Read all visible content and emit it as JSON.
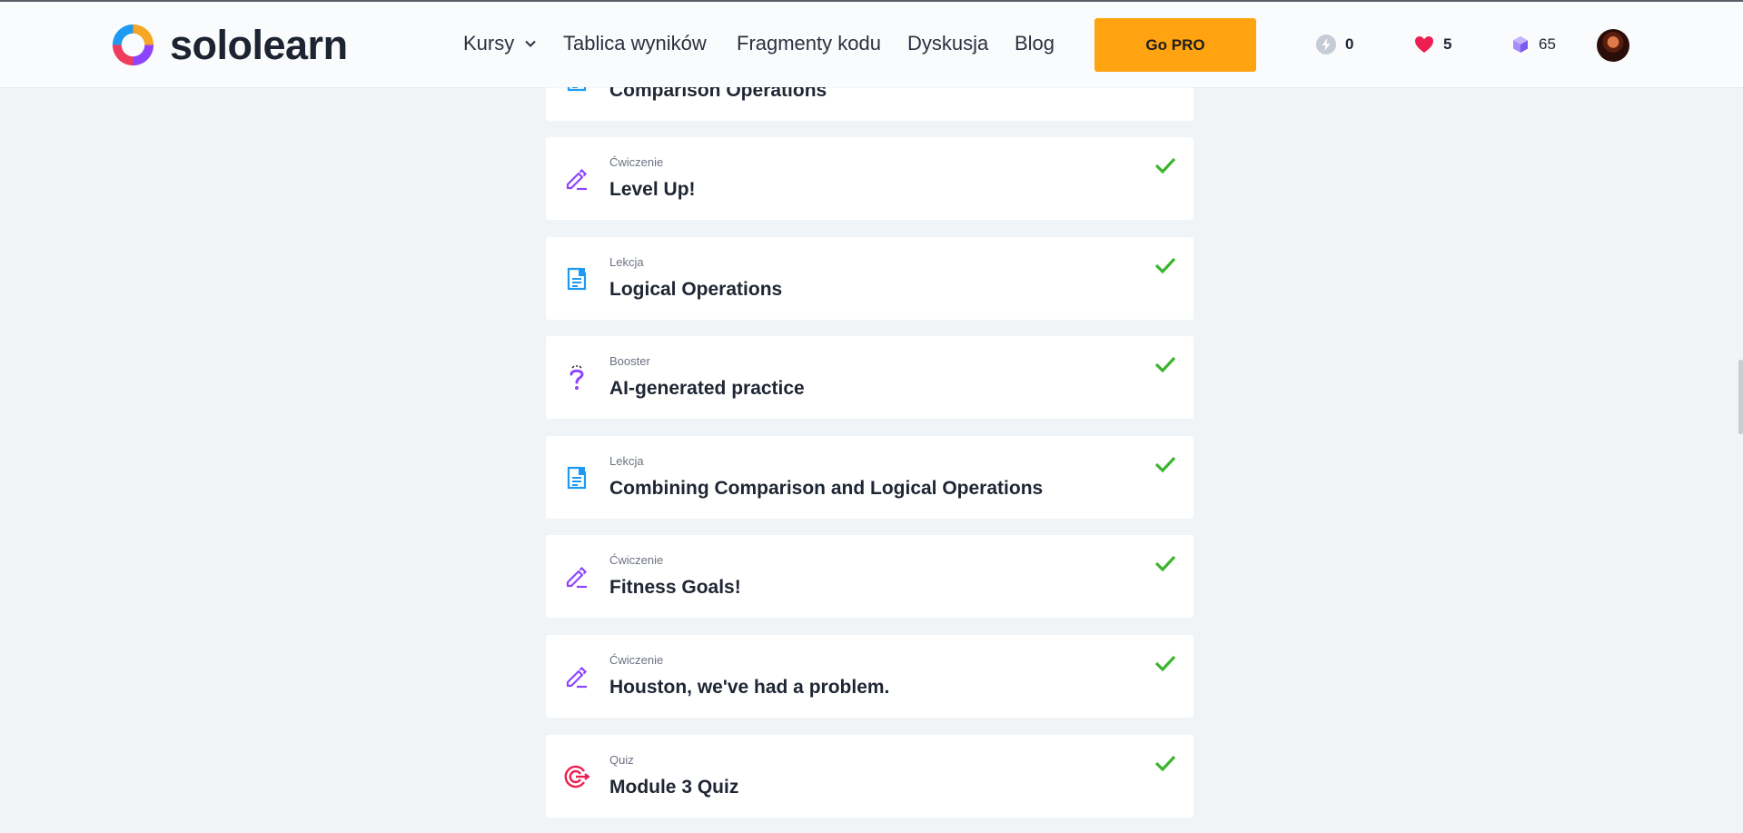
{
  "app": {
    "brand": "sololearn",
    "accent": "#ffa310",
    "check_color": "#3ab52f"
  },
  "nav": {
    "courses": "Kursy",
    "leaderboard": "Tablica wyników",
    "code_bits": "Fragmenty kodu",
    "discuss": "Dyskusja",
    "blog": "Blog",
    "go_pro": "Go PRO"
  },
  "stats": {
    "bolts": "0",
    "hearts": "5",
    "gems": "65"
  },
  "lessons": [
    {
      "type": "",
      "title": "Comparison Operations",
      "icon": "lesson-icon",
      "completed": true
    },
    {
      "type": "Ćwiczenie",
      "title": "Level Up!",
      "icon": "pencil-icon",
      "completed": true
    },
    {
      "type": "Lekcja",
      "title": "Logical Operations",
      "icon": "lesson-icon",
      "completed": true
    },
    {
      "type": "Booster",
      "title": "AI-generated practice",
      "icon": "question-icon",
      "completed": true
    },
    {
      "type": "Lekcja",
      "title": "Combining Comparison and Logical Operations",
      "icon": "lesson-icon",
      "completed": true
    },
    {
      "type": "Ćwiczenie",
      "title": "Fitness Goals!",
      "icon": "pencil-icon",
      "completed": true
    },
    {
      "type": "Ćwiczenie",
      "title": "Houston, we've had a problem.",
      "icon": "pencil-icon",
      "completed": true
    },
    {
      "type": "Quiz",
      "title": "Module 3 Quiz",
      "icon": "target-icon",
      "completed": true
    }
  ]
}
